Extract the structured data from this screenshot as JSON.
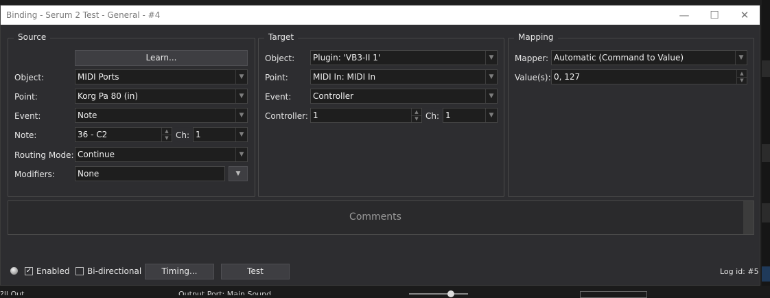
{
  "window": {
    "title": "Binding - Serum 2 Test - General - #4",
    "minimize": "—",
    "maximize": "☐",
    "close": "✕"
  },
  "source": {
    "title": "Source",
    "learn_button": "Learn...",
    "object_label": "Object:",
    "object_value": "MIDI Ports",
    "point_label": "Point:",
    "point_value": "Korg Pa 80 (in)",
    "event_label": "Event:",
    "event_value": "Note",
    "note_label": "Note:",
    "note_value": "36 - C2",
    "ch_label": "Ch:",
    "ch_value": "1",
    "routing_label": "Routing Mode:",
    "routing_value": "Continue",
    "modifiers_label": "Modifiers:",
    "modifiers_value": "None"
  },
  "target": {
    "title": "Target",
    "object_label": "Object:",
    "object_value": "Plugin: 'VB3-II 1'",
    "point_label": "Point:",
    "point_value": "MIDI In: MIDI In",
    "event_label": "Event:",
    "event_value": "Controller",
    "controller_label": "Controller:",
    "controller_value": "1",
    "ch_label": "Ch:",
    "ch_value": "1"
  },
  "mapping": {
    "title": "Mapping",
    "mapper_label": "Mapper:",
    "mapper_value": "Automatic (Command to Value)",
    "values_label": "Value(s):",
    "values_value": "0, 127"
  },
  "comments": {
    "placeholder": "Comments"
  },
  "footer": {
    "enabled_label": "Enabled",
    "enabled_checked": true,
    "bidirectional_label": "Bi-directional",
    "bidirectional_checked": false,
    "timing_button": "Timing...",
    "test_button": "Test",
    "log_id": "Log id: #5"
  },
  "background_app": {
    "bottom_left_text": "?ll Out",
    "bottom_mid_text": "Output Port: Main Sound"
  },
  "colors": {
    "window_bg": "#2d2d30",
    "field_bg": "#1e1e1e",
    "button_bg": "#3e3e42",
    "titlebar_bg": "#ffffff"
  }
}
